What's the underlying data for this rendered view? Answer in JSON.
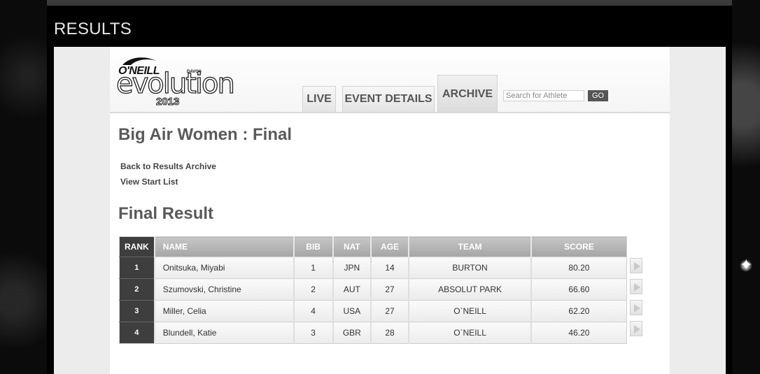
{
  "page": {
    "title": "RESULTS"
  },
  "logo": {
    "brand": "O'NEILL",
    "location": "DAVOS",
    "name": "evolution",
    "year": "2013"
  },
  "nav": {
    "tabs": [
      {
        "label": "LIVE",
        "active": false
      },
      {
        "label": "EVENT DETAILS",
        "active": false
      },
      {
        "label": "ARCHIVE",
        "active": true
      }
    ],
    "search_placeholder": "Search for Athlete",
    "search_value": "",
    "go_label": "GO"
  },
  "event": {
    "title": "Big Air Women : Final",
    "links": {
      "back": "Back to Results Archive",
      "start_list": "View Start List"
    },
    "section_title": "Final Result"
  },
  "table": {
    "headers": {
      "rank": "RANK",
      "name": "NAME",
      "bib": "BIB",
      "nat": "NAT",
      "age": "AGE",
      "team": "TEAM",
      "score": "SCORE"
    },
    "rows": [
      {
        "rank": "1",
        "name": "Onitsuka, Miyabi",
        "bib": "1",
        "nat": "JPN",
        "age": "14",
        "team": "BURTON",
        "score": "80.20"
      },
      {
        "rank": "2",
        "name": "Szumovski, Christine",
        "bib": "2",
        "nat": "AUT",
        "age": "27",
        "team": "ABSOLUT PARK",
        "score": "66.60"
      },
      {
        "rank": "3",
        "name": "Miller, Celia",
        "bib": "4",
        "nat": "USA",
        "age": "27",
        "team": "O`NEILL",
        "score": "62.20"
      },
      {
        "rank": "4",
        "name": "Blundell, Katie",
        "bib": "3",
        "nat": "GBR",
        "age": "28",
        "team": "O`NEILL",
        "score": "46.20"
      }
    ]
  },
  "colors": {
    "rank_cell": "#3e3e3e",
    "header_grey": "#b5b5b5",
    "title_text": "#5a5a5a"
  }
}
